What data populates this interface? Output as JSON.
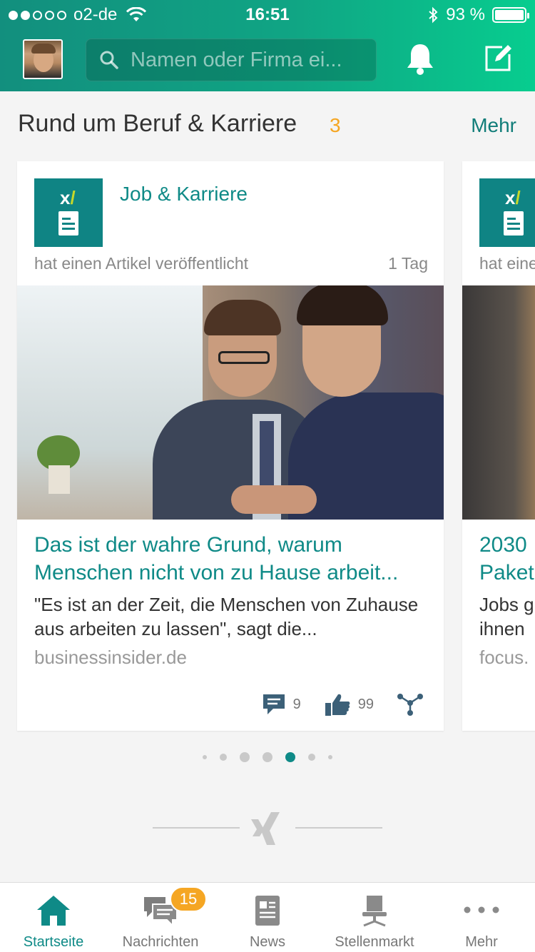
{
  "status_bar": {
    "carrier": "o2-de",
    "time": "16:51",
    "battery": "93 %"
  },
  "header": {
    "search_placeholder": "Namen oder Firma ei..."
  },
  "section": {
    "title": "Rund um Beruf & Karriere",
    "count": "3",
    "more": "Mehr"
  },
  "cards": [
    {
      "publisher": "Job & Karriere",
      "action": "hat einen Artikel veröffentlicht",
      "age": "1 Tag",
      "headline": "Das ist der wahre Grund, warum Menschen nicht von zu Hause arbeit...",
      "teaser": "\"Es ist an der Zeit, die Menschen von Zuhause aus arbeiten zu lassen\", sagt die...",
      "source": "businessinsider.de",
      "comments": "9",
      "likes": "99"
    },
    {
      "action": "hat eine",
      "headline_line1": "2030",
      "headline_line2": "Paket",
      "teaser_line1": "Jobs g",
      "teaser_line2": "ihnen",
      "source": "focus."
    }
  ],
  "pager": {
    "active_index": 4,
    "count": 7
  },
  "tabs": [
    {
      "label": "Startseite",
      "icon": "home-icon",
      "active": true
    },
    {
      "label": "Nachrichten",
      "icon": "chat-bubbles-icon",
      "badge": "15"
    },
    {
      "label": "News",
      "icon": "newspaper-icon"
    },
    {
      "label": "Stellenmarkt",
      "icon": "office-chair-icon"
    },
    {
      "label": "Mehr",
      "icon": "more-dots-icon"
    }
  ],
  "colors": {
    "accent": "#0f8a87",
    "header_gradient_start": "#128f7e",
    "header_gradient_end": "#07cd8f",
    "badge": "#f5a623"
  }
}
